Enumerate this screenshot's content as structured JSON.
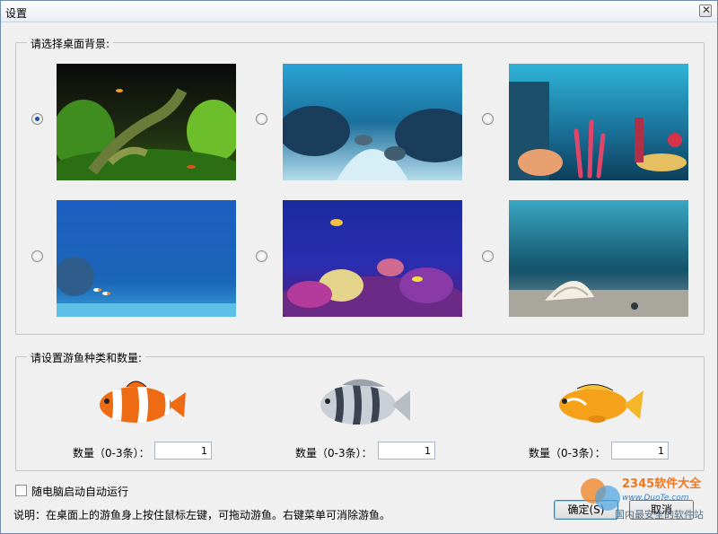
{
  "window": {
    "title": "设置"
  },
  "backgrounds": {
    "label": "请选择桌面背景:",
    "selected_index": 0,
    "items": [
      {
        "name": "tank",
        "checked": true
      },
      {
        "name": "reef-sand",
        "checked": false
      },
      {
        "name": "coral-garden",
        "checked": false
      },
      {
        "name": "deep-blue",
        "checked": false
      },
      {
        "name": "purple-reef",
        "checked": false
      },
      {
        "name": "shell-seabed",
        "checked": false
      }
    ]
  },
  "fish_settings": {
    "label": "请设置游鱼种类和数量:",
    "fish": [
      {
        "kind": "clownfish",
        "qty_label": "数量（0-3条）：",
        "qty_value": "1"
      },
      {
        "kind": "striped-fish",
        "qty_label": "数量（0-3条）：",
        "qty_value": "1"
      },
      {
        "kind": "orange-fish",
        "qty_label": "数量（0-3条）：",
        "qty_value": "1"
      }
    ]
  },
  "autostart": {
    "label": "随电脑启动自动运行",
    "checked": false
  },
  "hint": "说明：在桌面上的游鱼身上按住鼠标左键，可拖动游鱼。右键菜单可消除游鱼。",
  "buttons": {
    "ok": "确定(S)",
    "cancel": "取消"
  },
  "watermark": {
    "brand": "2345软件大全",
    "url": "www.DuoTe.com",
    "sub": "国内最安全的软件站"
  }
}
